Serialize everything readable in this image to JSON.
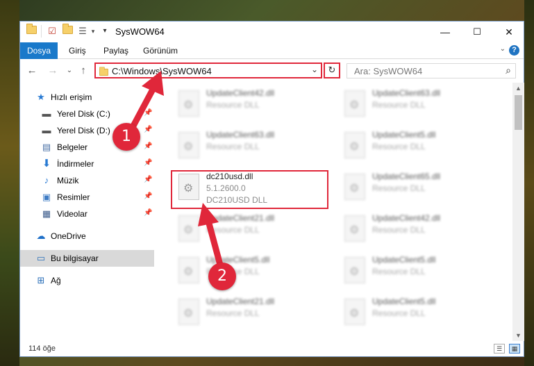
{
  "window": {
    "title": "SysWOW64",
    "minimize": "—",
    "maximize": "☐",
    "close": "✕"
  },
  "ribbon": {
    "tabs": [
      "Dosya",
      "Giriş",
      "Paylaş",
      "Görünüm"
    ]
  },
  "address": {
    "path": "C:\\Windows\\SysWOW64",
    "search_placeholder": "Ara: SysWOW64"
  },
  "sidebar": {
    "quick_access": "Hızlı erişim",
    "items": [
      {
        "label": "Yerel Disk (C:)",
        "icon": "drive-icon",
        "pinned": true
      },
      {
        "label": "Yerel Disk (D:)",
        "icon": "drive-icon",
        "pinned": true
      },
      {
        "label": "Belgeler",
        "icon": "documents-icon",
        "pinned": true
      },
      {
        "label": "İndirmeler",
        "icon": "download-icon",
        "pinned": true
      },
      {
        "label": "Müzik",
        "icon": "music-icon",
        "pinned": true
      },
      {
        "label": "Resimler",
        "icon": "pictures-icon",
        "pinned": true
      },
      {
        "label": "Videolar",
        "icon": "video-icon",
        "pinned": true
      }
    ],
    "onedrive": "OneDrive",
    "this_pc": "Bu bilgisayar",
    "network": "Ağ"
  },
  "files": {
    "left": [
      {
        "name": "UpdateClient42.dll",
        "desc": "Resource DLL"
      },
      {
        "name": "UpdateClient63.dll",
        "desc": "Resource DLL"
      },
      {
        "name": "dc210usd.dll",
        "version": "5.1.2600.0",
        "desc": "DC210USD DLL"
      },
      {
        "name": "UpdateClient21.dll",
        "desc": "Resource DLL"
      },
      {
        "name": "UpdateClient5.dll",
        "desc": "Resource DLL"
      },
      {
        "name": "UpdateClient21.dll",
        "desc": "Resource DLL"
      }
    ],
    "right": [
      {
        "name": "UpdateClient63.dll",
        "desc": "Resource DLL"
      },
      {
        "name": "UpdateClient5.dll",
        "desc": "Resource DLL"
      },
      {
        "name": "UpdateClient65.dll",
        "desc": "Resource DLL"
      },
      {
        "name": "UpdateClient42.dll",
        "desc": "Resource DLL"
      },
      {
        "name": "UpdateClient5.dll",
        "desc": "Resource DLL"
      },
      {
        "name": "UpdateClient5.dll",
        "desc": "Resource DLL"
      }
    ]
  },
  "status": {
    "item_count": "114 öğe"
  },
  "annotations": {
    "step1": "1",
    "step2": "2",
    "color": "#e0273a"
  }
}
